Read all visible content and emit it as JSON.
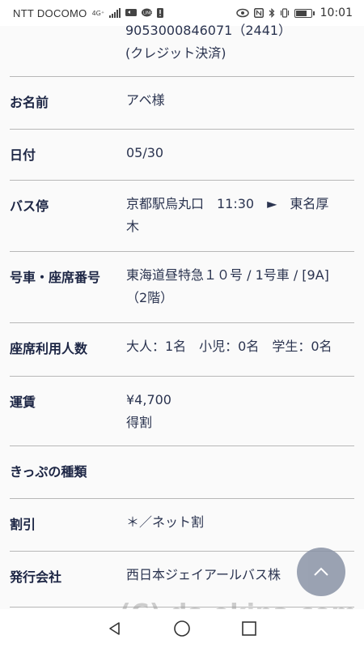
{
  "status_bar": {
    "carrier": "NTT DOCOMO",
    "network": "4G⁺",
    "time": "10:01",
    "battery_level": 0.8
  },
  "top_info": {
    "number_line": "9053000846071（2441）",
    "payment_line": "(クレジット決済)"
  },
  "rows": [
    {
      "label": "お名前",
      "value_lines": [
        "アベ様"
      ]
    },
    {
      "label": "日付",
      "value_lines": [
        "05/30"
      ]
    },
    {
      "label": "バス停",
      "value_lines": [
        "京都駅烏丸口　11:30　►　東名厚",
        "木"
      ]
    },
    {
      "label": "号車・座席番号",
      "value_lines": [
        "東海道昼特急１０号 / 1号車 / [9A]",
        "（2階）"
      ]
    },
    {
      "label": "座席利用人数",
      "value_lines": [
        "大人：1名　小児：0名　学生：0名"
      ]
    },
    {
      "label": "運賃",
      "value_lines": [
        "¥4,700",
        "得割"
      ]
    },
    {
      "label": "きっぷの種類",
      "value_lines": []
    },
    {
      "label": "割引",
      "value_lines": [
        "＊／ネット割"
      ]
    },
    {
      "label": "発行会社",
      "value_lines": [
        "西日本ジェイアールバス株"
      ]
    }
  ],
  "scroll_top_button": {
    "icon": "chevron-up-icon"
  },
  "nav_bar": {
    "back": "back-triangle-icon",
    "home": "home-circle-icon",
    "recents": "recents-square-icon"
  },
  "watermark": "(C) ds-okina.com"
}
